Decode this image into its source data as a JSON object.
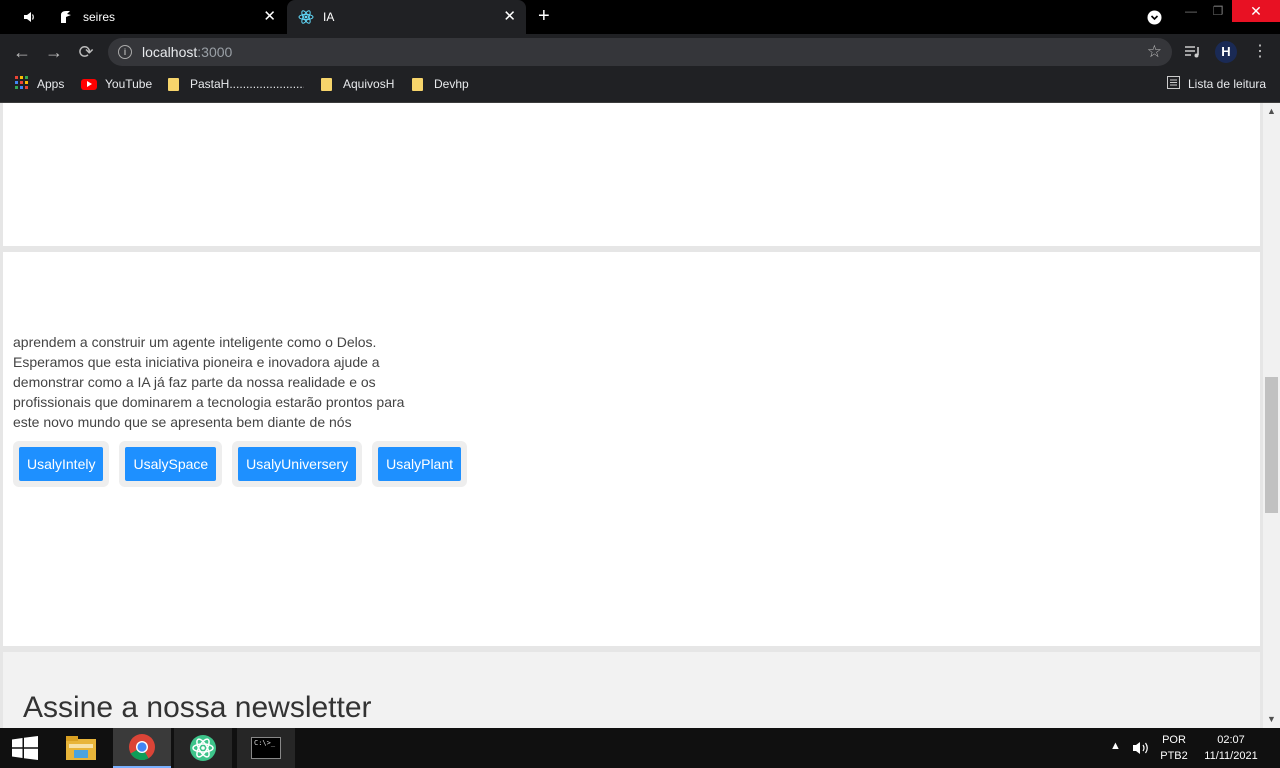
{
  "browser": {
    "tabs": [
      {
        "title": "seires",
        "active": false
      },
      {
        "title": "IA",
        "active": true
      }
    ],
    "new_tab_symbol": "+",
    "url": {
      "host": "localhost",
      "port": ":3000"
    },
    "bookmarks": [
      {
        "label": "Apps",
        "icon": "apps-grid-icon"
      },
      {
        "label": "YouTube",
        "icon": "youtube-icon"
      },
      {
        "label": "PastaH..............................",
        "icon": "folder-icon"
      },
      {
        "label": "AquivosH",
        "icon": "folder-icon"
      },
      {
        "label": "Devhp",
        "icon": "folder-icon"
      }
    ],
    "reading_list": "Lista de leitura",
    "profile_initial": "H"
  },
  "page": {
    "body_text": "aprendem a construir um agente inteligente como o Delos. Esperamos que esta iniciativa pioneira e inovadora ajude a demonstrar como a IA já faz parte da nossa realidade e os profissionais que dominarem a tecnologia estarão prontos para este novo mundo que se apresenta bem diante de nós",
    "buttons": [
      "UsalyIntely",
      "UsalySpace",
      "UsalyUniversery",
      "UsalyPlant"
    ],
    "newsletter_heading": "Assine a nossa newsletter",
    "button_color": "#1e90ff"
  },
  "taskbar": {
    "language": "POR",
    "layout": "PTB2",
    "time": "02:07",
    "date": "11/11/2021",
    "terminal_text": "C:\\>_"
  }
}
